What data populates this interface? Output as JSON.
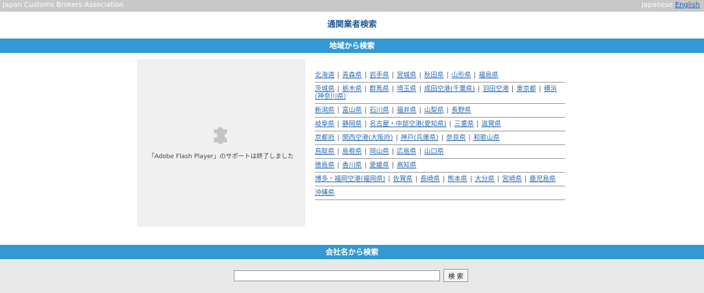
{
  "header": {
    "org_name": "Japan Customs Brokers Association",
    "lang_current": "Japanese",
    "lang_sep": " ",
    "lang_link": "English"
  },
  "page": {
    "title": "通関業者検索"
  },
  "region_section": {
    "title": "地域から検索",
    "flash_message": "「Adobe Flash Player」のサポートは終了しました",
    "rows": [
      [
        "北海道",
        "青森県",
        "岩手県",
        "宮城県",
        "秋田県",
        "山形県",
        "福島県"
      ],
      [
        "茨城県",
        "栃木県",
        "群馬県",
        "埼玉県",
        "成田空港(千葉県)",
        "羽田空港",
        "東京都",
        "横浜(神奈川県)"
      ],
      [
        "新潟県",
        "富山県",
        "石川県",
        "福井県",
        "山梨県",
        "長野県"
      ],
      [
        "岐阜県",
        "静岡県",
        "名古屋・中部空港(愛知県)",
        "三重県",
        "滋賀県"
      ],
      [
        "京都府",
        "関西空港(大阪府)",
        "神戸(兵庫県)",
        "奈良県",
        "和歌山県"
      ],
      [
        "鳥取県",
        "島根県",
        "岡山県",
        "広島県",
        "山口県"
      ],
      [
        "徳島県",
        "香川県",
        "愛媛県",
        "高知県"
      ],
      [
        "博多・福岡空港(福岡県)",
        "佐賀県",
        "長崎県",
        "熊本県",
        "大分県",
        "宮崎県",
        "鹿児島県"
      ],
      [
        "沖縄県"
      ]
    ],
    "separator": "|"
  },
  "company_section": {
    "title": "会社名から検索",
    "input_value": "",
    "search_button": "検 索"
  },
  "colors": {
    "band": "#3299d3",
    "topbar": "#c8c8c8",
    "link": "#2a6ab1",
    "title": "#1f5c99"
  },
  "icons": {
    "flash_placeholder": "puzzle-piece-icon"
  }
}
